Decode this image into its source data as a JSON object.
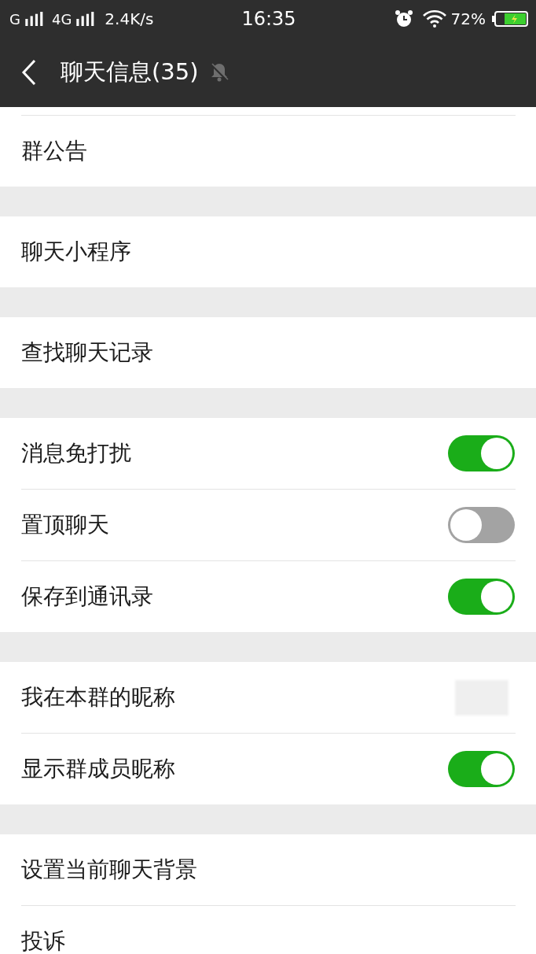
{
  "status_bar": {
    "network_1": "G",
    "network_2": "4G",
    "speed": "2.4K/s",
    "time": "16:35",
    "battery": "72%"
  },
  "header": {
    "title": "聊天信息(35)",
    "muted": true
  },
  "groups": [
    {
      "rows": [
        {
          "kind": "link",
          "label": "群公告"
        }
      ]
    },
    {
      "rows": [
        {
          "kind": "link",
          "label": "聊天小程序"
        }
      ]
    },
    {
      "rows": [
        {
          "kind": "link",
          "label": "查找聊天记录"
        }
      ]
    },
    {
      "rows": [
        {
          "kind": "switch",
          "label": "消息免打扰",
          "on": true
        },
        {
          "kind": "switch",
          "label": "置顶聊天",
          "on": false
        },
        {
          "kind": "switch",
          "label": "保存到通讯录",
          "on": true
        }
      ]
    },
    {
      "rows": [
        {
          "kind": "hidden_value",
          "label": "我在本群的昵称"
        },
        {
          "kind": "switch",
          "label": "显示群成员昵称",
          "on": true
        }
      ]
    },
    {
      "rows": [
        {
          "kind": "link",
          "label": "设置当前聊天背景"
        },
        {
          "kind": "link",
          "label": "投诉"
        }
      ]
    }
  ]
}
